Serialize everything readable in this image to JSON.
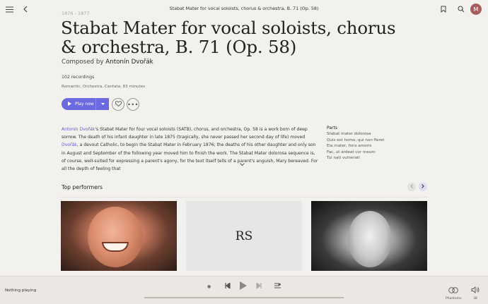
{
  "header": {
    "title": "Stabat Mater for vocal soloists, chorus & orchestra, B. 71 (Op. 58)",
    "avatar_initial": "M"
  },
  "work": {
    "years": "1876 - 1877",
    "title": "Stabat Mater for vocal soloists, chorus & orchestra, B. 71 (Op. 58)",
    "composed_by_prefix": "Composed by",
    "composer": "Antonín Dvořák",
    "recordings": "102 recordings",
    "tags": "Romantic, Orchestra, Cantata, 83 minutes"
  },
  "actions": {
    "play_label": "Play now"
  },
  "description": {
    "link1": "Antonín Dvořák",
    "text1": "'s Stabat Mater for four vocal soloists (SATB), chorus, and orchestra, Op. 58 is a work born of deep sorrow. The death of his infant daughter in late 1875 (tragically, she never passed her second day of life) moved ",
    "link2": "Dvořák",
    "text2": ", a devout Catholic, to begin the Stabat Mater in February 1876; the deaths of his other daughter and only son in August and September of the following year moved him to finish the work. The Stabat Mater dolorosa sequence is, of course, well-suited for expressing a parent's agony, for the text itself tells of a parent's anguish, Mary bereaved. For all the depth of feeling that"
  },
  "parts": {
    "heading": "Parts",
    "items": [
      "Stabat mater dolorosa",
      "Quis est homo, qui non fleret",
      "Eia mater, fons amoris",
      "Fac, ut ardeat cor meum",
      "Tui nati vulnerati"
    ]
  },
  "performers": {
    "heading": "Top performers",
    "placeholder_initials": "RS"
  },
  "player": {
    "status": "Nothing playing",
    "device_name": "Phantoms",
    "volume": "38"
  },
  "colors": {
    "accent": "#6c6ae0",
    "background": "#f3f1ee",
    "avatar": "#a85d5d"
  }
}
